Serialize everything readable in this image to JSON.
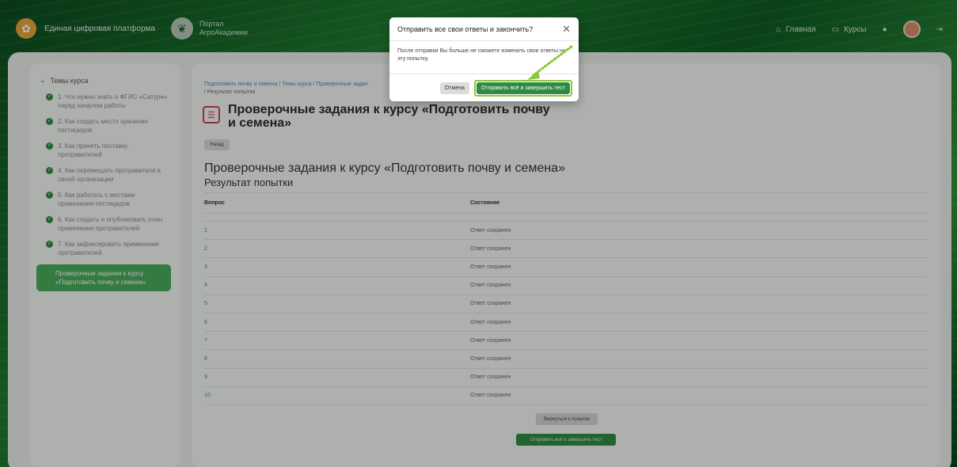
{
  "header": {
    "brand": "Единая цифровая платформа",
    "portal_line1": "Портал",
    "portal_line2": "АгроАкадемии",
    "nav": {
      "home": "Главная",
      "courses": "Курсы"
    }
  },
  "sidebar": {
    "heading": "Темы курса",
    "items": [
      {
        "label": "1. Что нужно знать о ФГИС «Сатурн» перед началом работы"
      },
      {
        "label": "2. Как создать место хранения пестицидов"
      },
      {
        "label": "3. Как принять поставку протравителей"
      },
      {
        "label": "4. Как перемещать протравители в своей организации"
      },
      {
        "label": "5. Как работать с местами применения пестицидов"
      },
      {
        "label": "6. Как создать и опубликовать план применения протравителей"
      },
      {
        "label": "7. Как зафиксировать применение протравителей"
      }
    ],
    "active_item": "Проверочные задания к курсу «Подготовить почву и семена»"
  },
  "content": {
    "breadcrumb": {
      "part1": "Подготовить почву и семена",
      "sep": "/",
      "part2": "Темы курса",
      "part3": "Проверочные задан",
      "current": "Результат попытки"
    },
    "title_line1": "Проверочные задания к курсу «Подготовить почву",
    "title_line2": "и семена»",
    "back_label": "Назад",
    "heading": "Проверочные задания к курсу «Подготовить почву и семена»",
    "subheading": "Результат попытки",
    "table": {
      "headers": [
        "Вопрос",
        "Состояние"
      ],
      "rows": [
        {
          "q": "1",
          "status": "Ответ сохранен"
        },
        {
          "q": "2",
          "status": "Ответ сохранен"
        },
        {
          "q": "3",
          "status": "Ответ сохранен"
        },
        {
          "q": "4",
          "status": "Ответ сохранен"
        },
        {
          "q": "5",
          "status": "Ответ сохранен"
        },
        {
          "q": "6",
          "status": "Ответ сохранен"
        },
        {
          "q": "7",
          "status": "Ответ сохранен"
        },
        {
          "q": "8",
          "status": "Ответ сохранен"
        },
        {
          "q": "9",
          "status": "Ответ сохранен"
        },
        {
          "q": "10",
          "status": "Ответ сохранен"
        }
      ]
    },
    "return_label": "Вернуться к попытке",
    "submit_label": "Отправить всё и завершить тест"
  },
  "modal": {
    "title": "Отправить все свои ответы и закончить?",
    "body": "После отправки Вы больше не сможете изменить свои ответы на эту попытку.",
    "cancel": "Отмена",
    "confirm": "Отправить всё и завершить тест"
  },
  "colors": {
    "accent": "#2f8b43",
    "highlight": "#8cc63f",
    "link": "#4a7fd0"
  },
  "icons": [
    "wheat-logo-icon",
    "leaf-icon",
    "home-icon",
    "courses-icon",
    "bell-icon",
    "logout-icon",
    "check-icon",
    "chevron-down-icon",
    "quiz-icon",
    "close-icon"
  ]
}
